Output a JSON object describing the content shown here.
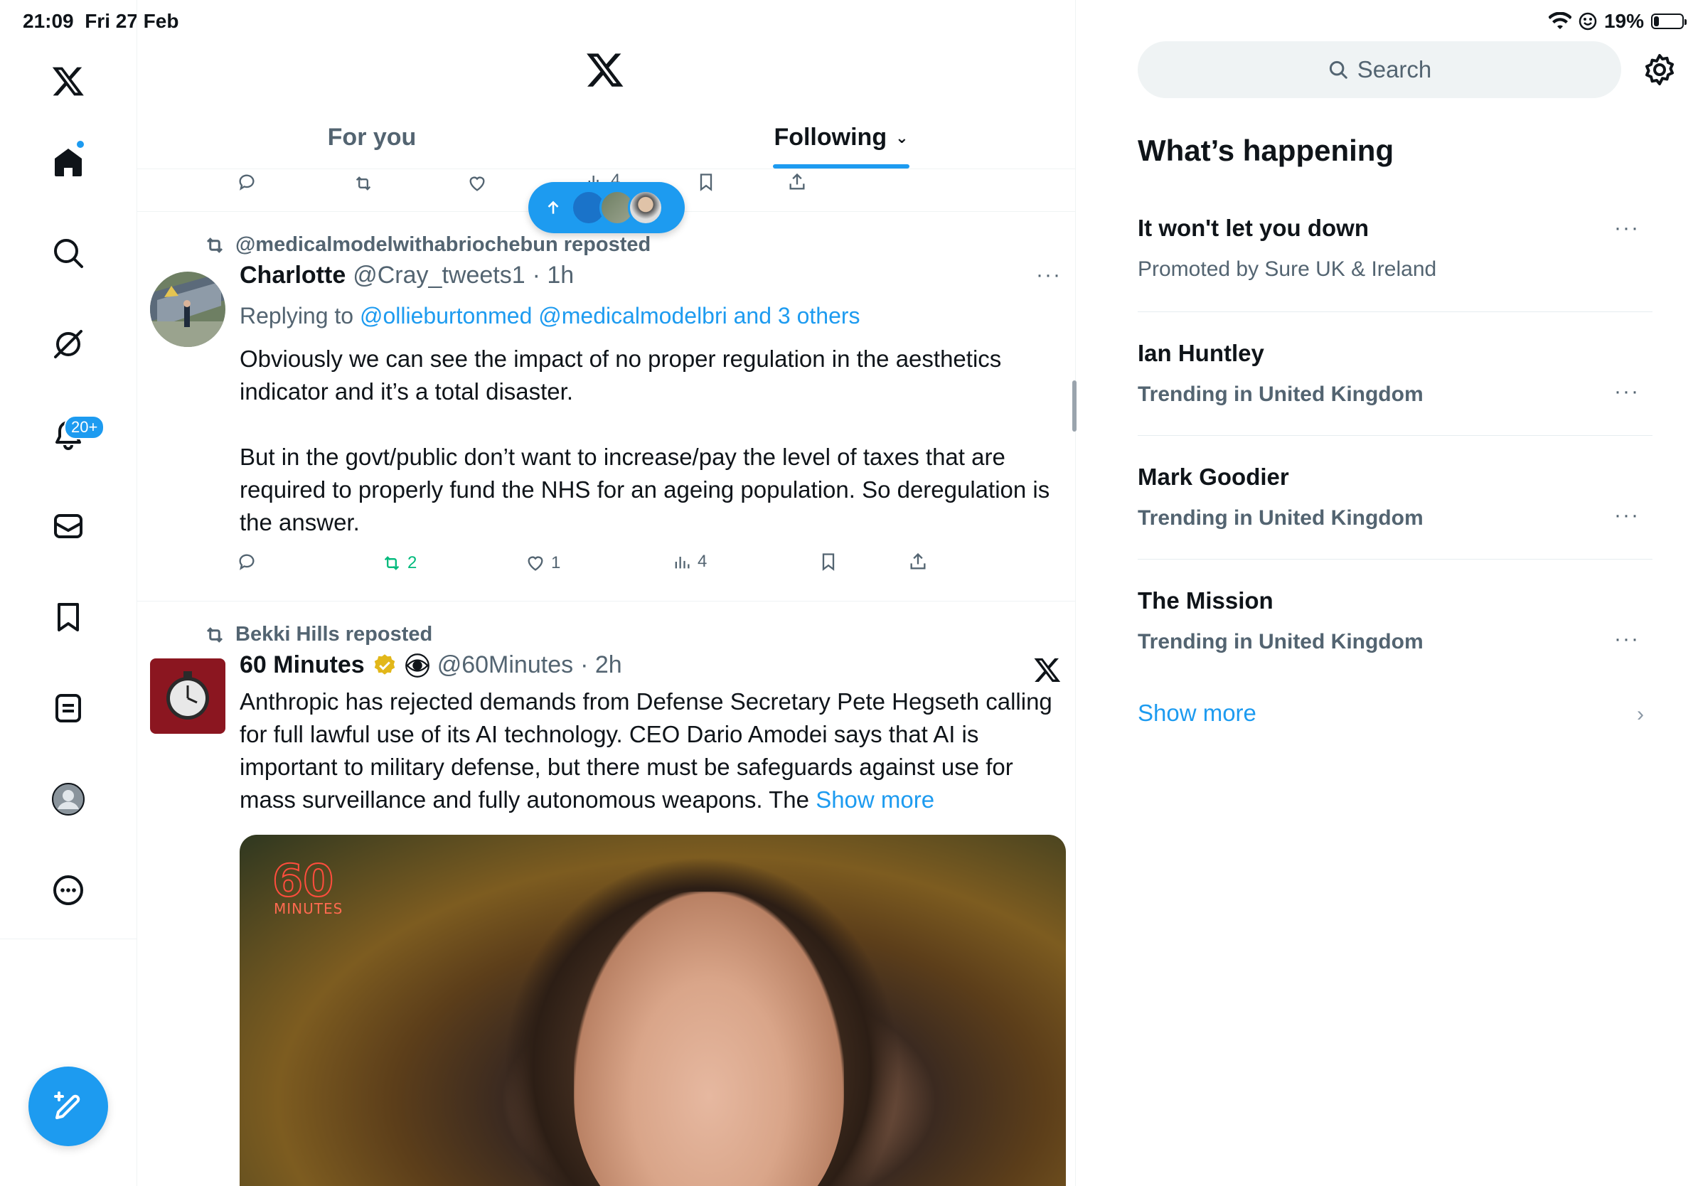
{
  "status_bar": {
    "time": "21:09",
    "date": "Fri 27 Feb",
    "battery": "19%",
    "battery_level": 0.19
  },
  "nav": {
    "items": [
      "x-logo",
      "home",
      "search",
      "grok",
      "notifications",
      "messages",
      "bookmarks",
      "lists",
      "profile",
      "more"
    ],
    "notifications_badge": "20+"
  },
  "header": {
    "tabs": [
      {
        "label": "For you",
        "active": false
      },
      {
        "label": "Following",
        "active": true
      }
    ],
    "following_chevron": "⌄"
  },
  "top_post_actions": {
    "views": "4"
  },
  "posts": [
    {
      "reposted_by": "@medicalmodelwithabriochebun reposted",
      "author_name": "Charlotte",
      "author_handle": "@Cray_tweets1",
      "time": "· 1h",
      "replying_prefix": "Replying to",
      "replying_to": "@ollieburtonmed @medicalmodelbri and 3 others",
      "text_p1": "Obviously we can see the impact of no proper regulation in the aesthetics indicator and it’s a total disaster.",
      "text_p2": "But in the govt/public don’t want to increase/pay the level of taxes that are required to properly fund the NHS for an ageing population. So deregulation is the answer.",
      "reposts": "2",
      "likes": "1",
      "views": "4",
      "more": "···"
    },
    {
      "reposted_by": "Bekki Hills reposted",
      "author_name": "60 Minutes",
      "author_handle": "@60Minutes",
      "time": "· 2h",
      "text": "Anthropic has rejected demands from Defense Secretary Pete Hegseth calling for full lawful use of its AI technology. CEO Dario Amodei says that AI is important to military defense, but there must be safeguards against use for mass surveillance and fully autonomous weapons. The",
      "show_more": "Show more",
      "media_logo": "60",
      "media_logo_sub": "MINUTES"
    }
  ],
  "right": {
    "search_placeholder": "Search",
    "section_title": "What’s happening",
    "trends": [
      {
        "title": "It won't let you down",
        "subtitle": "Promoted by Sure UK & Ireland"
      },
      {
        "title": "Ian Huntley",
        "subtitle": "Trending in United Kingdom"
      },
      {
        "title": "Mark Goodier",
        "subtitle": "Trending in United Kingdom"
      },
      {
        "title": "The Mission",
        "subtitle": "Trending in United Kingdom"
      }
    ],
    "trend_more": "···",
    "show_more": "Show more",
    "show_more_chevron": "›"
  },
  "colors": {
    "accent": "#1d9bf0",
    "repost_green": "#00ba7c",
    "muted": "#536471"
  }
}
